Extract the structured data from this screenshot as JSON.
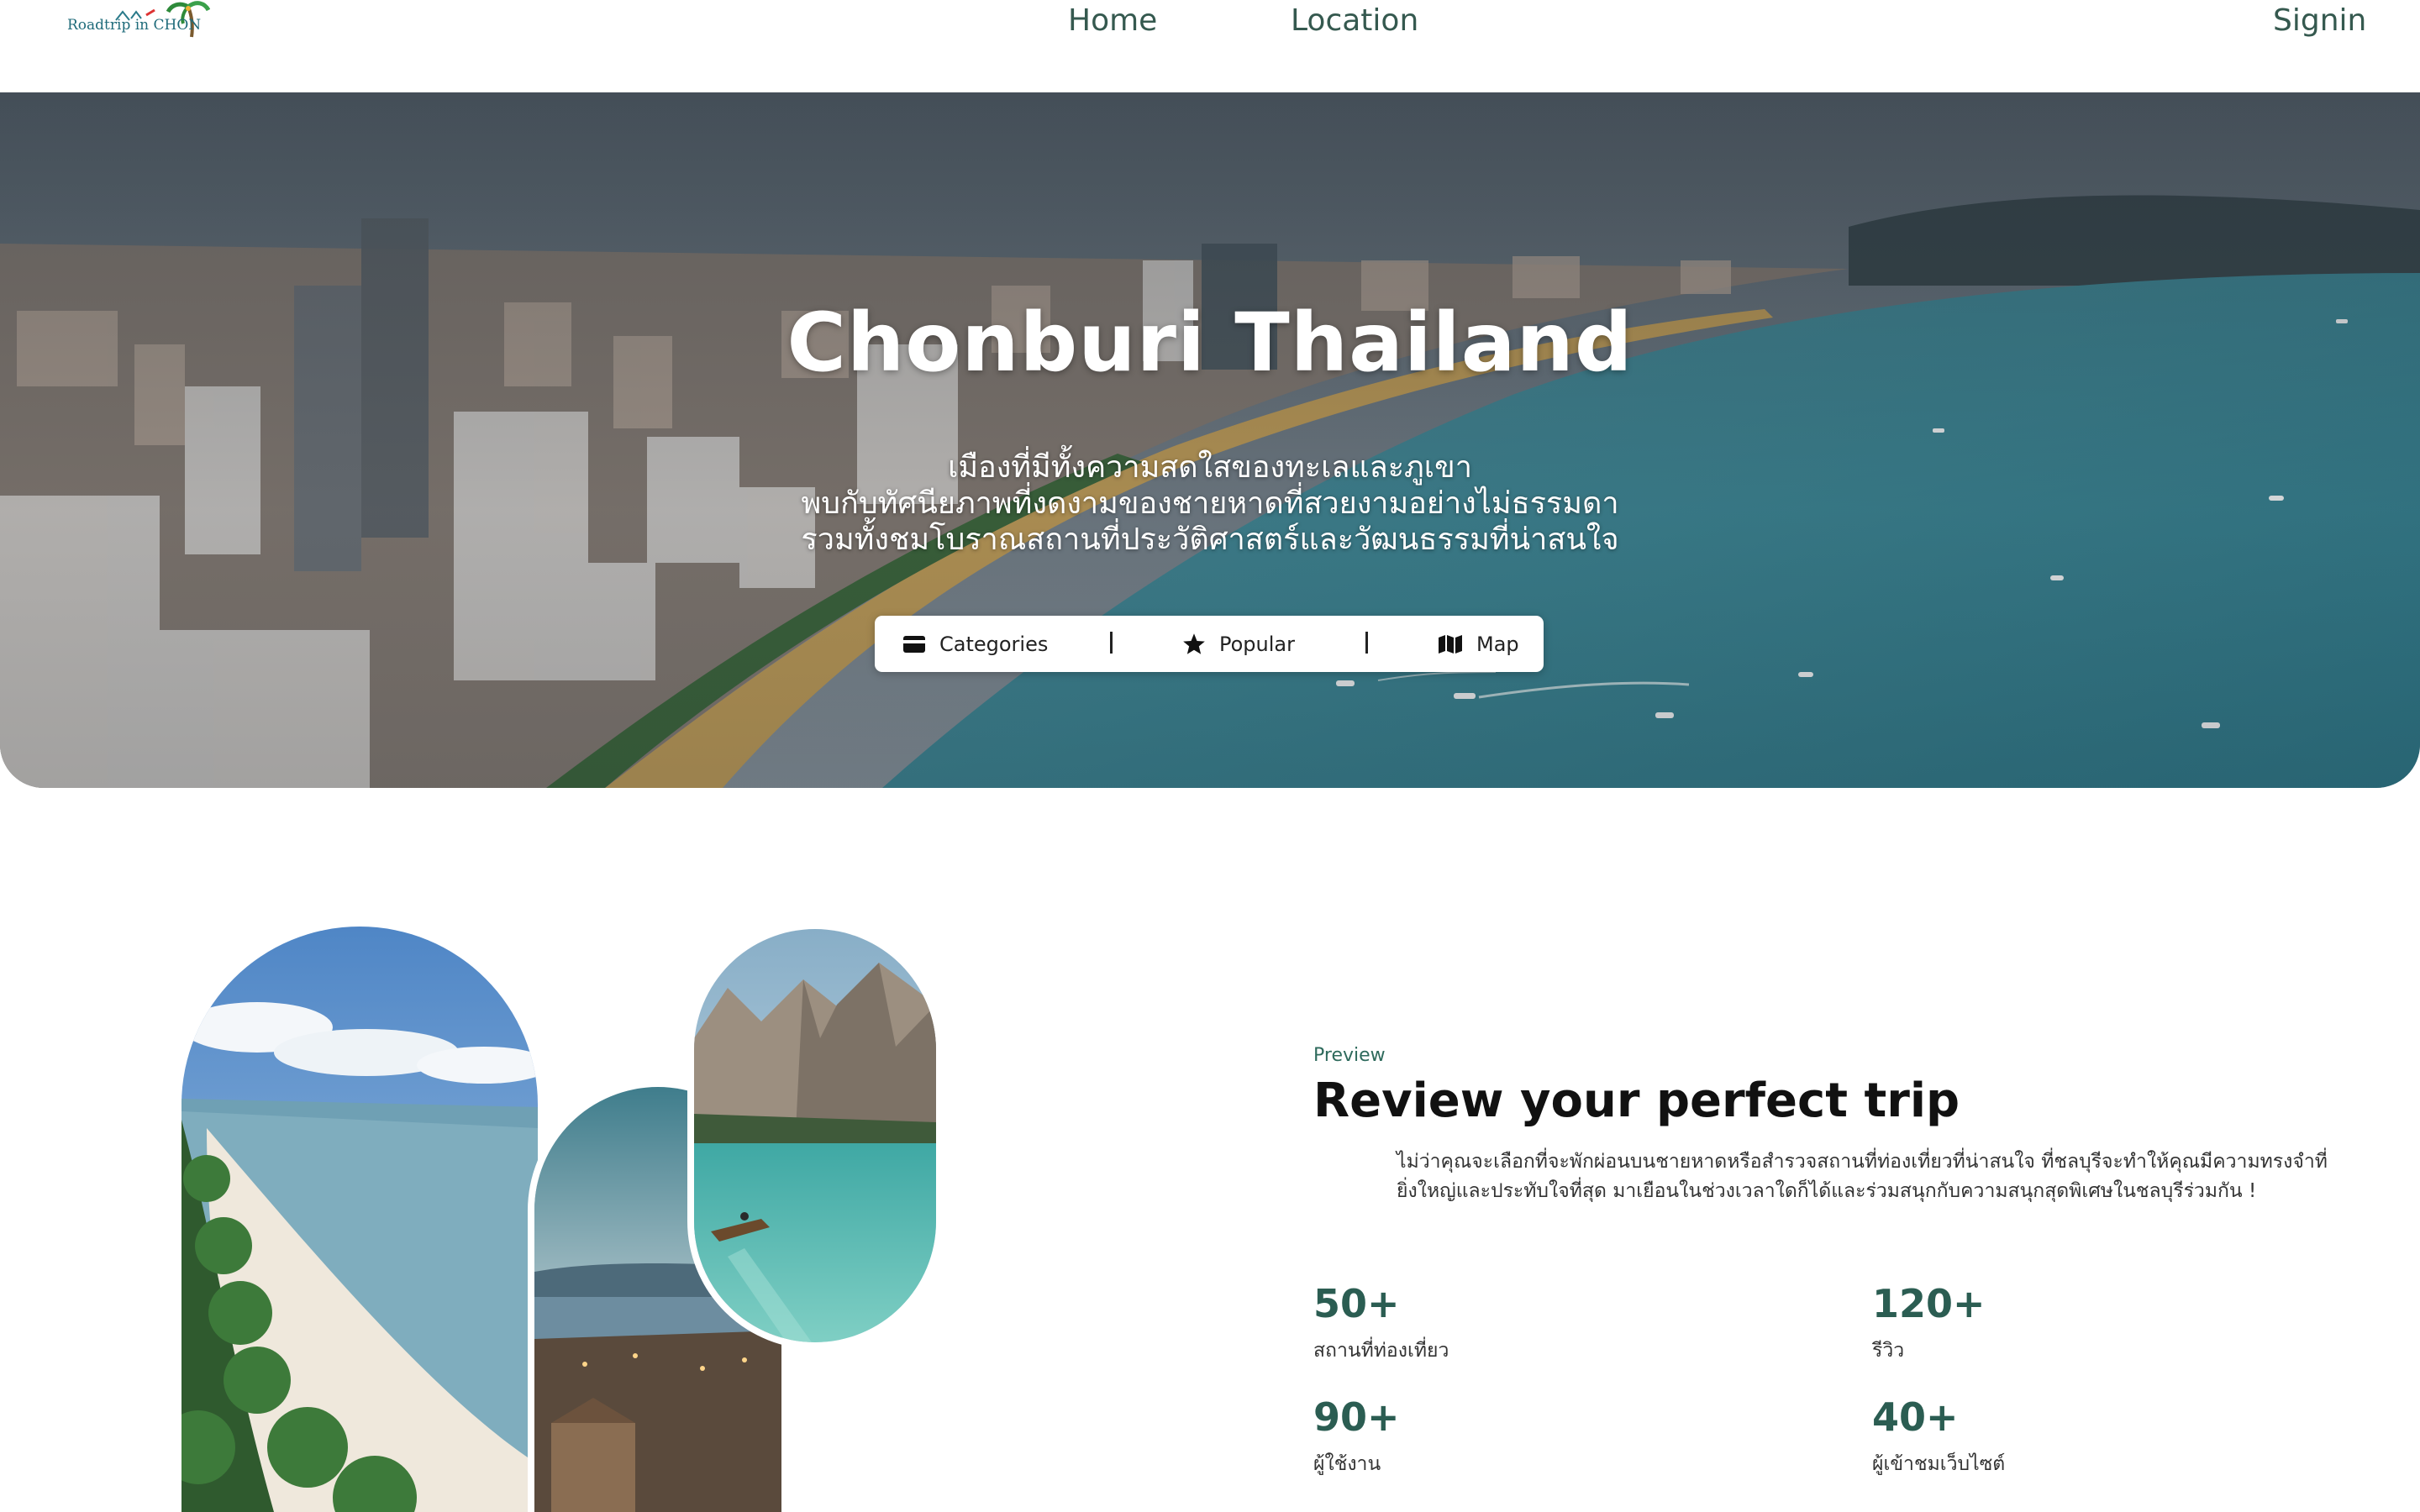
{
  "brand": {
    "logo_text": "Roadtrip in CHON"
  },
  "nav": {
    "home": "Home",
    "location": "Location",
    "signin": "Signin"
  },
  "hero": {
    "title": "Chonburi Thailand",
    "subtitle_lines": [
      "เมืองที่มีทั้งความสดใสของทะเลและภูเขา",
      "พบกับทัศนียภาพที่งดงามของชายหาดที่สวยงามอย่างไม่ธรรมดา",
      "รวมทั้งชมโบราณสถานที่ประวัติศาสตร์และวัฒนธรรมที่น่าสนใจ"
    ],
    "buttons": [
      {
        "label": "Categories",
        "icon": "card-icon"
      },
      {
        "label": "Popular",
        "icon": "star-icon"
      },
      {
        "label": "Map",
        "icon": "map-icon"
      }
    ],
    "separator": "|"
  },
  "preview": {
    "eyebrow": "Preview",
    "title": "Review your perfect trip",
    "description": "ไม่ว่าคุณจะเลือกที่จะพักผ่อนบนชายหาดหรือสำรวจสถานที่ท่องเที่ยวที่น่าสนใจ ที่ชลบุรีจะทำให้คุณมีความทรงจำที่ยิ่งใหญ่และประทับใจที่สุด มาเยือนในช่วงเวลาใดก็ได้และร่วมสนุกกับความสนุกสุดพิเศษในชลบุรีร่วมกัน !",
    "stats": [
      {
        "value": "50+",
        "label": "สถานที่ท่องเที่ยว"
      },
      {
        "value": "120+",
        "label": "รีวิว"
      },
      {
        "value": "90+",
        "label": "ผู้ใช้งาน"
      },
      {
        "value": "40+",
        "label": "ผู้เข้าชมเว็บไซต์"
      }
    ]
  },
  "colors": {
    "accent": "#2b5d52",
    "nav_text": "#35594f",
    "sea": "#3f8fa0",
    "sand": "#c9a35a"
  }
}
